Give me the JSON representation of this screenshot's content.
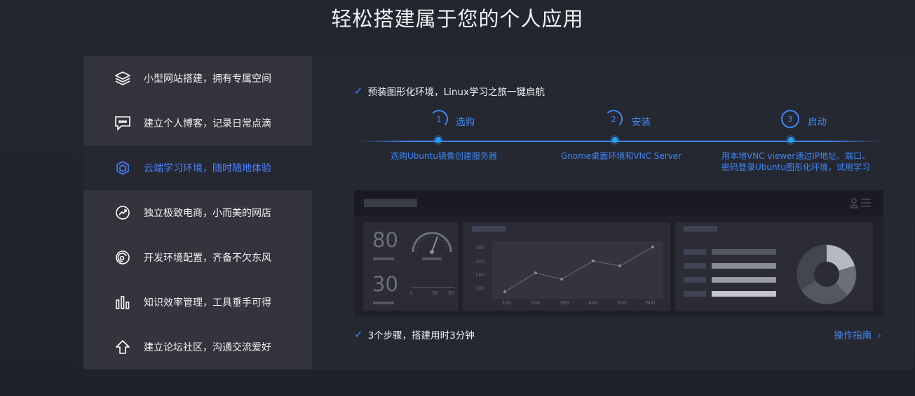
{
  "page": {
    "title": "轻松搭建属于您的个人应用"
  },
  "sidebar": {
    "items": [
      {
        "icon": "layers-icon",
        "label": "小型网站搭建，拥有专属空间"
      },
      {
        "icon": "chat-bubble-icon",
        "label": "建立个人博客，记录日常点滴"
      },
      {
        "icon": "cube-icon",
        "label": "云端学习环境，随时随地体验",
        "active": true
      },
      {
        "icon": "trend-chart-icon",
        "label": "独立极致电商，小而美的网店"
      },
      {
        "icon": "spiral-icon",
        "label": "开发环境配置，齐备不欠东风"
      },
      {
        "icon": "bar-chart-icon",
        "label": "知识效率管理，工具垂手可得"
      },
      {
        "icon": "upload-arrow-icon",
        "label": "建立论坛社区，沟通交流爱好"
      }
    ]
  },
  "content": {
    "intro": "预装图形化环境，Linux学习之旅一键启航",
    "steps": [
      {
        "number": "1",
        "title": "选购",
        "desc": "选购Ubuntu镜像创建服务器"
      },
      {
        "number": "2",
        "title": "安装",
        "desc": "Gnome桌面环境和VNC Server"
      },
      {
        "number": "3",
        "title": "启动",
        "desc_line1": "用本地VNC viewer通过IP地址、端口、",
        "desc_line2": "密码登录Ubuntu图形化环境，试用学习"
      }
    ],
    "summary": "3个步骤，搭建用时3分钟",
    "guide_link": "操作指南"
  },
  "mock_dashboard": {
    "stat1": "80",
    "stat2": "30",
    "gauge_ticks": [
      "0",
      "30",
      "50"
    ],
    "line_y_ticks": [
      "400",
      "300",
      "200",
      "100"
    ],
    "line_x_ticks": [
      "100",
      "200",
      "300",
      "400",
      "500",
      "600"
    ]
  },
  "colors": {
    "accent": "#3d86f5",
    "sidebar_bg": "#33343c",
    "panel_bg": "#262831"
  }
}
